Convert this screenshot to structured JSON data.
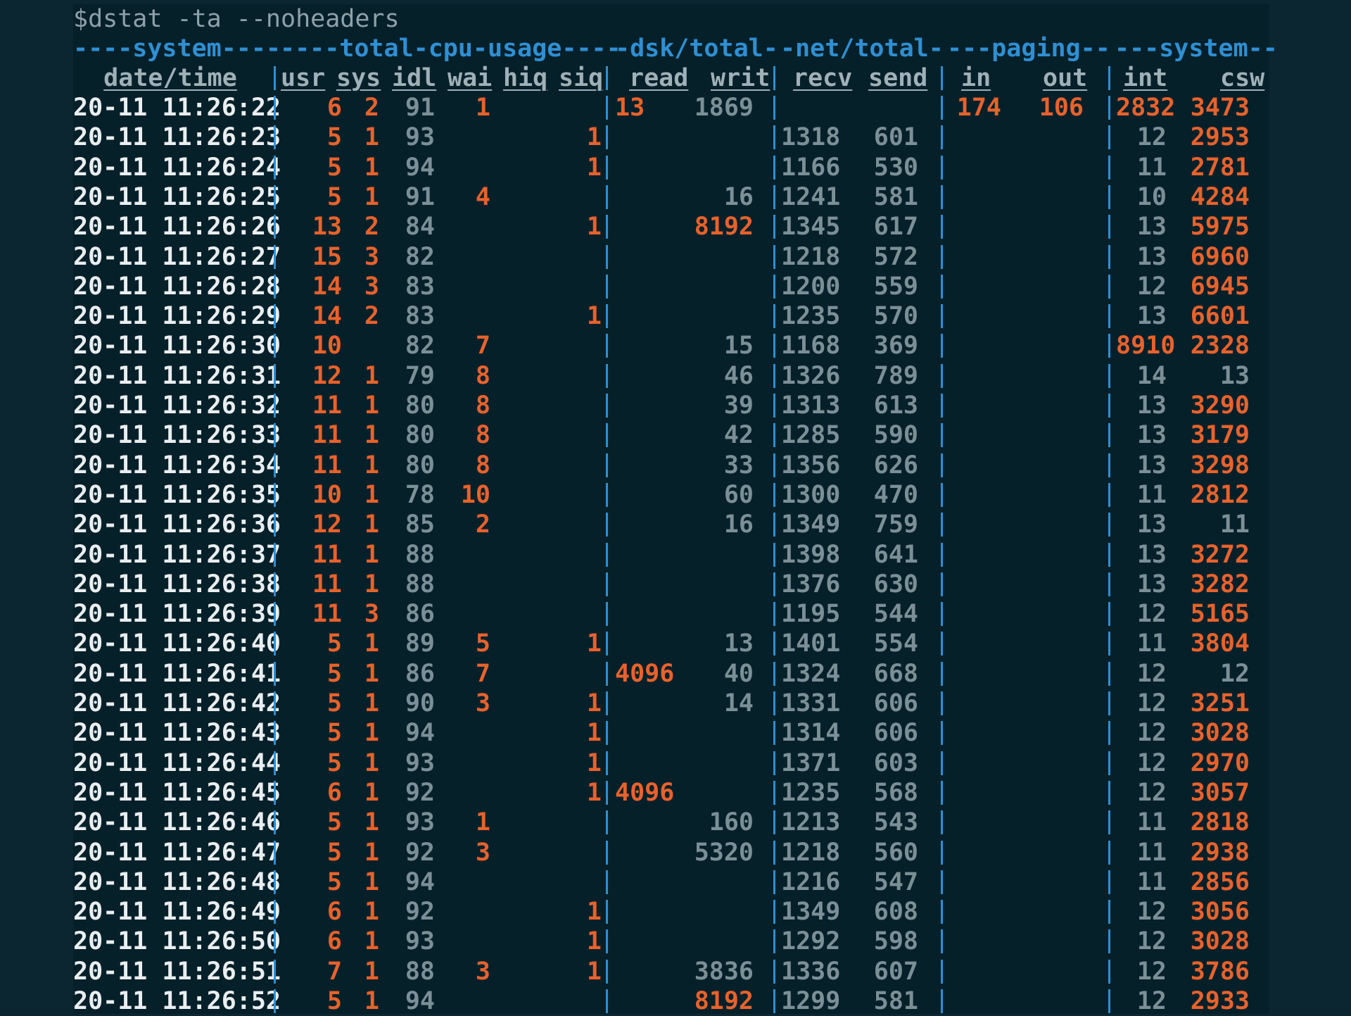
{
  "command": "$dstat -ta --noheaders",
  "groups": [
    {
      "label": "----system----"
    },
    {
      "label": "----total-cpu-usage----"
    },
    {
      "label": "-dsk/total-"
    },
    {
      "label": "-net/total-"
    },
    {
      "label": "---paging--"
    },
    {
      "label": "---system--"
    }
  ],
  "headers": {
    "datetime": "date/time",
    "usr": "usr",
    "sys": "sys",
    "idl": "idl",
    "wai": "wai",
    "hiq": "hiq",
    "siq": "siq",
    "read": "read",
    "writ": "writ",
    "recv": "recv",
    "send": "send",
    "in": "in",
    "out": "out",
    "int": "int",
    "csw": "csw"
  },
  "colors": {
    "background": "#06202a",
    "group_header": "#2f8fd2",
    "column_header": "#9fb0b7",
    "timestamp": "#e9eef0",
    "highlight": "#e8622c",
    "dim": "#7b8f96"
  },
  "rows": [
    {
      "datetime": "20-11 11:26:22",
      "usr": "6",
      "sys": "2",
      "idl": "91",
      "wai": "1",
      "hiq": "",
      "siq": "",
      "read": "13",
      "writ": "1869",
      "recv": "",
      "send": "",
      "in": "174",
      "out": "106",
      "int": "2832",
      "csw": "3473"
    },
    {
      "datetime": "20-11 11:26:23",
      "usr": "5",
      "sys": "1",
      "idl": "93",
      "wai": "",
      "hiq": "",
      "siq": "1",
      "read": "",
      "writ": "",
      "recv": "1318",
      "send": "601",
      "in": "",
      "out": "",
      "int": "12",
      "csw": "2953"
    },
    {
      "datetime": "20-11 11:26:24",
      "usr": "5",
      "sys": "1",
      "idl": "94",
      "wai": "",
      "hiq": "",
      "siq": "1",
      "read": "",
      "writ": "",
      "recv": "1166",
      "send": "530",
      "in": "",
      "out": "",
      "int": "11",
      "csw": "2781"
    },
    {
      "datetime": "20-11 11:26:25",
      "usr": "5",
      "sys": "1",
      "idl": "91",
      "wai": "4",
      "hiq": "",
      "siq": "",
      "read": "",
      "writ": "16",
      "recv": "1241",
      "send": "581",
      "in": "",
      "out": "",
      "int": "10",
      "csw": "4284"
    },
    {
      "datetime": "20-11 11:26:26",
      "usr": "13",
      "sys": "2",
      "idl": "84",
      "wai": "",
      "hiq": "",
      "siq": "1",
      "read": "",
      "writ": "8192",
      "recv": "1345",
      "send": "617",
      "in": "",
      "out": "",
      "int": "13",
      "csw": "5975"
    },
    {
      "datetime": "20-11 11:26:27",
      "usr": "15",
      "sys": "3",
      "idl": "82",
      "wai": "",
      "hiq": "",
      "siq": "",
      "read": "",
      "writ": "",
      "recv": "1218",
      "send": "572",
      "in": "",
      "out": "",
      "int": "13",
      "csw": "6960"
    },
    {
      "datetime": "20-11 11:26:28",
      "usr": "14",
      "sys": "3",
      "idl": "83",
      "wai": "",
      "hiq": "",
      "siq": "",
      "read": "",
      "writ": "",
      "recv": "1200",
      "send": "559",
      "in": "",
      "out": "",
      "int": "12",
      "csw": "6945"
    },
    {
      "datetime": "20-11 11:26:29",
      "usr": "14",
      "sys": "2",
      "idl": "83",
      "wai": "",
      "hiq": "",
      "siq": "1",
      "read": "",
      "writ": "",
      "recv": "1235",
      "send": "570",
      "in": "",
      "out": "",
      "int": "13",
      "csw": "6601"
    },
    {
      "datetime": "20-11 11:26:30",
      "usr": "10",
      "sys": "",
      "idl": "82",
      "wai": "7",
      "hiq": "",
      "siq": "",
      "read": "",
      "writ": "15",
      "recv": "1168",
      "send": "369",
      "in": "",
      "out": "",
      "int": "8910",
      "csw": "2328"
    },
    {
      "datetime": "20-11 11:26:31",
      "usr": "12",
      "sys": "1",
      "idl": "79",
      "wai": "8",
      "hiq": "",
      "siq": "",
      "read": "",
      "writ": "46",
      "recv": "1326",
      "send": "789",
      "in": "",
      "out": "",
      "int": "14",
      "csw": "13"
    },
    {
      "datetime": "20-11 11:26:32",
      "usr": "11",
      "sys": "1",
      "idl": "80",
      "wai": "8",
      "hiq": "",
      "siq": "",
      "read": "",
      "writ": "39",
      "recv": "1313",
      "send": "613",
      "in": "",
      "out": "",
      "int": "13",
      "csw": "3290"
    },
    {
      "datetime": "20-11 11:26:33",
      "usr": "11",
      "sys": "1",
      "idl": "80",
      "wai": "8",
      "hiq": "",
      "siq": "",
      "read": "",
      "writ": "42",
      "recv": "1285",
      "send": "590",
      "in": "",
      "out": "",
      "int": "13",
      "csw": "3179"
    },
    {
      "datetime": "20-11 11:26:34",
      "usr": "11",
      "sys": "1",
      "idl": "80",
      "wai": "8",
      "hiq": "",
      "siq": "",
      "read": "",
      "writ": "33",
      "recv": "1356",
      "send": "626",
      "in": "",
      "out": "",
      "int": "13",
      "csw": "3298"
    },
    {
      "datetime": "20-11 11:26:35",
      "usr": "10",
      "sys": "1",
      "idl": "78",
      "wai": "10",
      "hiq": "",
      "siq": "",
      "read": "",
      "writ": "60",
      "recv": "1300",
      "send": "470",
      "in": "",
      "out": "",
      "int": "11",
      "csw": "2812"
    },
    {
      "datetime": "20-11 11:26:36",
      "usr": "12",
      "sys": "1",
      "idl": "85",
      "wai": "2",
      "hiq": "",
      "siq": "",
      "read": "",
      "writ": "16",
      "recv": "1349",
      "send": "759",
      "in": "",
      "out": "",
      "int": "13",
      "csw": "11"
    },
    {
      "datetime": "20-11 11:26:37",
      "usr": "11",
      "sys": "1",
      "idl": "88",
      "wai": "",
      "hiq": "",
      "siq": "",
      "read": "",
      "writ": "",
      "recv": "1398",
      "send": "641",
      "in": "",
      "out": "",
      "int": "13",
      "csw": "3272"
    },
    {
      "datetime": "20-11 11:26:38",
      "usr": "11",
      "sys": "1",
      "idl": "88",
      "wai": "",
      "hiq": "",
      "siq": "",
      "read": "",
      "writ": "",
      "recv": "1376",
      "send": "630",
      "in": "",
      "out": "",
      "int": "13",
      "csw": "3282"
    },
    {
      "datetime": "20-11 11:26:39",
      "usr": "11",
      "sys": "3",
      "idl": "86",
      "wai": "",
      "hiq": "",
      "siq": "",
      "read": "",
      "writ": "",
      "recv": "1195",
      "send": "544",
      "in": "",
      "out": "",
      "int": "12",
      "csw": "5165"
    },
    {
      "datetime": "20-11 11:26:40",
      "usr": "5",
      "sys": "1",
      "idl": "89",
      "wai": "5",
      "hiq": "",
      "siq": "1",
      "read": "",
      "writ": "13",
      "recv": "1401",
      "send": "554",
      "in": "",
      "out": "",
      "int": "11",
      "csw": "3804"
    },
    {
      "datetime": "20-11 11:26:41",
      "usr": "5",
      "sys": "1",
      "idl": "86",
      "wai": "7",
      "hiq": "",
      "siq": "",
      "read": "4096",
      "writ": "40",
      "recv": "1324",
      "send": "668",
      "in": "",
      "out": "",
      "int": "12",
      "csw": "12"
    },
    {
      "datetime": "20-11 11:26:42",
      "usr": "5",
      "sys": "1",
      "idl": "90",
      "wai": "3",
      "hiq": "",
      "siq": "1",
      "read": "",
      "writ": "14",
      "recv": "1331",
      "send": "606",
      "in": "",
      "out": "",
      "int": "12",
      "csw": "3251"
    },
    {
      "datetime": "20-11 11:26:43",
      "usr": "5",
      "sys": "1",
      "idl": "94",
      "wai": "",
      "hiq": "",
      "siq": "1",
      "read": "",
      "writ": "",
      "recv": "1314",
      "send": "606",
      "in": "",
      "out": "",
      "int": "12",
      "csw": "3028"
    },
    {
      "datetime": "20-11 11:26:44",
      "usr": "5",
      "sys": "1",
      "idl": "93",
      "wai": "",
      "hiq": "",
      "siq": "1",
      "read": "",
      "writ": "",
      "recv": "1371",
      "send": "603",
      "in": "",
      "out": "",
      "int": "12",
      "csw": "2970"
    },
    {
      "datetime": "20-11 11:26:45",
      "usr": "6",
      "sys": "1",
      "idl": "92",
      "wai": "",
      "hiq": "",
      "siq": "1",
      "read": "4096",
      "writ": "",
      "recv": "1235",
      "send": "568",
      "in": "",
      "out": "",
      "int": "12",
      "csw": "3057"
    },
    {
      "datetime": "20-11 11:26:46",
      "usr": "5",
      "sys": "1",
      "idl": "93",
      "wai": "1",
      "hiq": "",
      "siq": "",
      "read": "",
      "writ": "160",
      "recv": "1213",
      "send": "543",
      "in": "",
      "out": "",
      "int": "11",
      "csw": "2818"
    },
    {
      "datetime": "20-11 11:26:47",
      "usr": "5",
      "sys": "1",
      "idl": "92",
      "wai": "3",
      "hiq": "",
      "siq": "",
      "read": "",
      "writ": "5320",
      "recv": "1218",
      "send": "560",
      "in": "",
      "out": "",
      "int": "11",
      "csw": "2938"
    },
    {
      "datetime": "20-11 11:26:48",
      "usr": "5",
      "sys": "1",
      "idl": "94",
      "wai": "",
      "hiq": "",
      "siq": "",
      "read": "",
      "writ": "",
      "recv": "1216",
      "send": "547",
      "in": "",
      "out": "",
      "int": "11",
      "csw": "2856"
    },
    {
      "datetime": "20-11 11:26:49",
      "usr": "6",
      "sys": "1",
      "idl": "92",
      "wai": "",
      "hiq": "",
      "siq": "1",
      "read": "",
      "writ": "",
      "recv": "1349",
      "send": "608",
      "in": "",
      "out": "",
      "int": "12",
      "csw": "3056"
    },
    {
      "datetime": "20-11 11:26:50",
      "usr": "6",
      "sys": "1",
      "idl": "93",
      "wai": "",
      "hiq": "",
      "siq": "1",
      "read": "",
      "writ": "",
      "recv": "1292",
      "send": "598",
      "in": "",
      "out": "",
      "int": "12",
      "csw": "3028"
    },
    {
      "datetime": "20-11 11:26:51",
      "usr": "7",
      "sys": "1",
      "idl": "88",
      "wai": "3",
      "hiq": "",
      "siq": "1",
      "read": "",
      "writ": "3836",
      "recv": "1336",
      "send": "607",
      "in": "",
      "out": "",
      "int": "12",
      "csw": "3786"
    },
    {
      "datetime": "20-11 11:26:52",
      "usr": "5",
      "sys": "1",
      "idl": "94",
      "wai": "",
      "hiq": "",
      "siq": "",
      "read": "",
      "writ": "8192",
      "recv": "1299",
      "send": "581",
      "in": "",
      "out": "",
      "int": "12",
      "csw": "2933"
    }
  ]
}
